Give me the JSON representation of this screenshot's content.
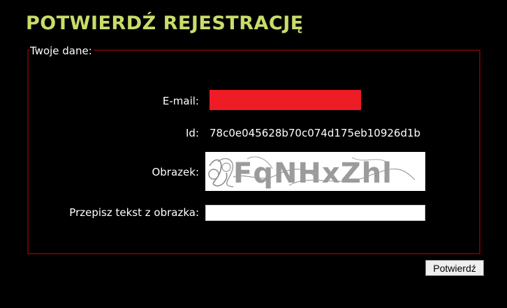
{
  "page": {
    "title": "POTWIERDŹ REJESTRACJĘ"
  },
  "form": {
    "legend": "Twoje dane:",
    "email_label": "E-mail:",
    "id_label": "Id:",
    "id_value": "78c0e045628b70c074d175eb10926d1b",
    "captcha_label": "Obrazek:",
    "captcha_text": "FqNHxZhl",
    "rewrite_label": "Przepisz tekst z obrazka:",
    "rewrite_value": "",
    "submit_label": "Potwierdź"
  },
  "colors": {
    "background": "#000000",
    "title": "#c9dc6a",
    "fieldset_border": "#6b0000",
    "email_field_fill": "#ee1c25"
  }
}
